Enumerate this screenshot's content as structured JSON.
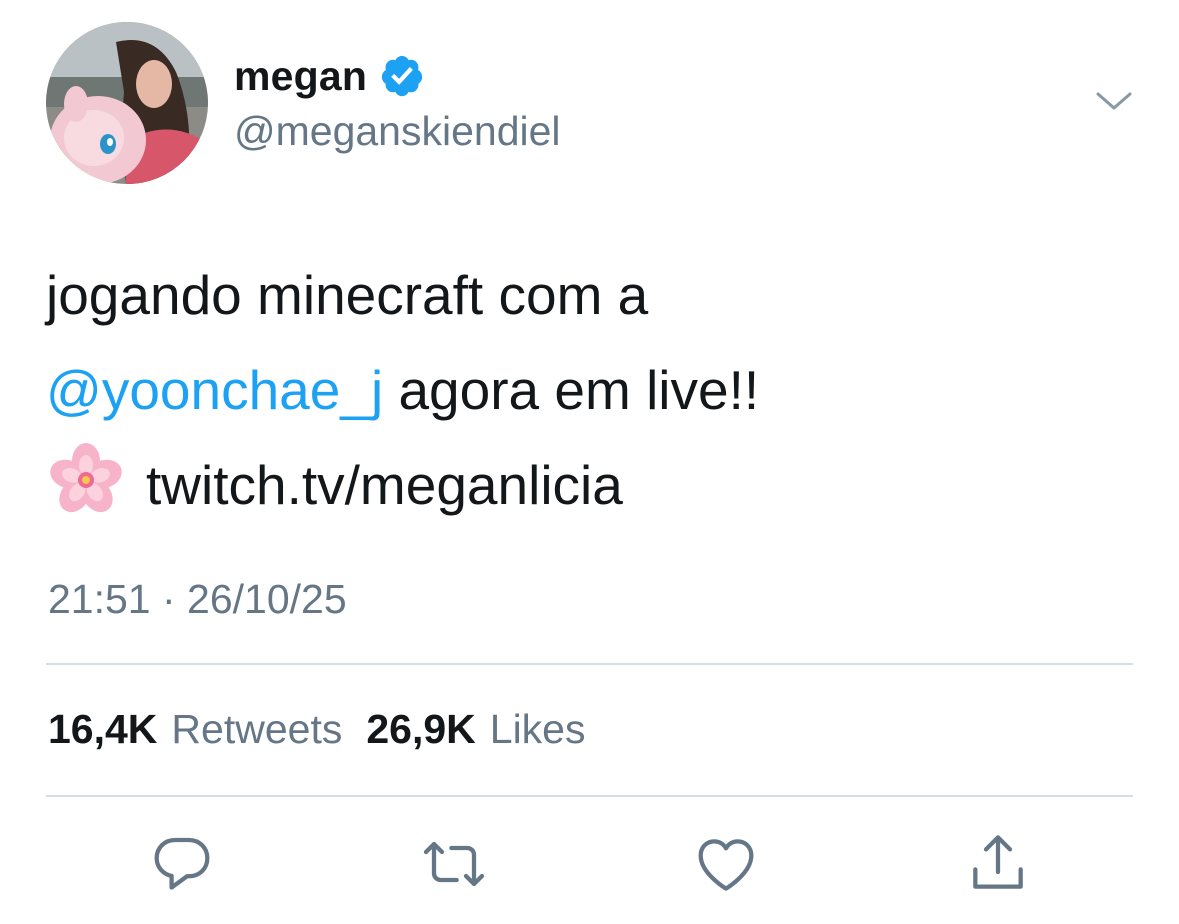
{
  "author": {
    "display_name": "megan",
    "handle": "@meganskiendiel",
    "verified": true
  },
  "tweet": {
    "line1": "jogando minecraft com a",
    "mention": "@yoonchae_j",
    "line2_rest": " agora em live!!",
    "link_text": "twitch.tv/meganlicia",
    "emoji": "cherry-blossom"
  },
  "timestamp": "21:51 · 26/10/25",
  "stats": {
    "retweets_count": "16,4K",
    "retweets_label": "Retweets",
    "likes_count": "26,9K",
    "likes_label": "Likes"
  },
  "actions": [
    "reply-icon",
    "retweet-icon",
    "like-icon",
    "share-icon"
  ],
  "colors": {
    "link": "#1da1f2",
    "secondary_text": "#657786",
    "primary_text": "#14171a",
    "divider": "#d6dde3"
  }
}
